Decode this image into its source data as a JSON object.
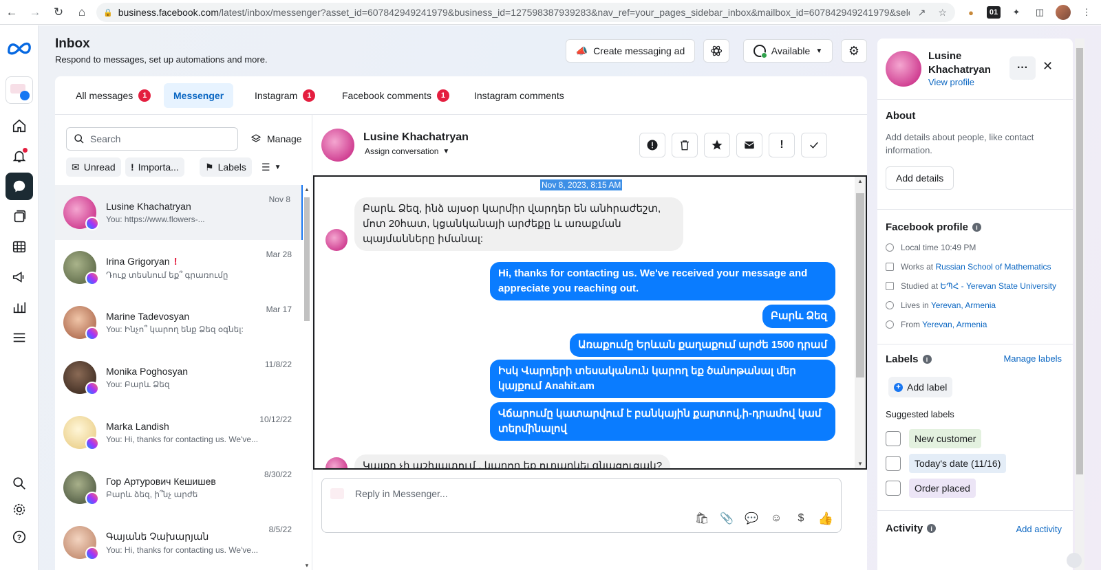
{
  "browser": {
    "url_host": "business.facebook.com",
    "url_path": "/latest/inbox/messenger?asset_id=607842949241979&business_id=127598387939283&nav_ref=your_pages_sidebar_inbox&mailbox_id=607842949241979&selec..."
  },
  "header": {
    "title": "Inbox",
    "subtitle": "Respond to messages, set up automations and more.",
    "create_ad_label": "Create messaging ad",
    "status_label": "Available"
  },
  "tabs": [
    {
      "label": "All messages",
      "badge": "1"
    },
    {
      "label": "Messenger",
      "badge": ""
    },
    {
      "label": "Instagram",
      "badge": "1"
    },
    {
      "label": "Facebook comments",
      "badge": "1"
    },
    {
      "label": "Instagram comments",
      "badge": ""
    }
  ],
  "list": {
    "search_placeholder": "Search",
    "manage_label": "Manage",
    "filters": {
      "unread": "Unread",
      "important": "Importa...",
      "labels": "Labels"
    },
    "conversations": [
      {
        "name": "Lusine Khachatryan",
        "preview": "You: https://www.flowers-...",
        "date": "Nov 8"
      },
      {
        "name": "Irina Grigoryan",
        "preview": "Դուք տեսնում եք՞ գրառումը",
        "date": "Mar 28"
      },
      {
        "name": "Marine Tadevosyan",
        "preview": "You: Ինչո՞ կարող ենք Ձեզ օգնել:",
        "date": "Mar 17"
      },
      {
        "name": "Monika Poghosyan",
        "preview": "You: Բարև Ձեզ",
        "date": "11/8/22"
      },
      {
        "name": "Marka Landish",
        "preview": "You: Hi, thanks for contacting us. We've...",
        "date": "10/12/22"
      },
      {
        "name": "Гор Артурович Кешишев",
        "preview": "Բարև ձեզ, ի՞նչ արժե",
        "date": "8/30/22"
      },
      {
        "name": "Գայանե Չախարյան",
        "preview": "You: Hi, thanks for contacting us. We've...",
        "date": "8/5/22"
      }
    ]
  },
  "chat": {
    "name": "Lusine Khachatryan",
    "assign_label": "Assign conversation",
    "date_stamp": "Nov 8, 2023, 8:15 AM",
    "messages": {
      "in1": "Բարև Ձեզ, ինձ  այսօր կարմիր վարդեր են անհրաժեշտ, մոտ 20հատ, կցանկանայի արժեքը և առաքման պայմանները իմանալ:",
      "out1": "Hi, thanks for contacting us. We've received your message and appreciate you reaching out.",
      "out2": "Բարև Ձեզ",
      "out3": "Առաքումը Երևան քաղաքում արժե 1500 դրամ",
      "out4": "Իսկ Վարդերի տեսականուն կարող եք ծանոթանալ մեր կայքում Anahit.am",
      "out5": "Վճարումը կատարվում է բանկային քարտով,ի-դրամով կամ տերմինալով",
      "in2": "Կայքը չի աշխատում , կարող եք ուղարկել գնացուցակ?"
    },
    "reply_placeholder": "Reply in Messenger..."
  },
  "details": {
    "name": "Lusine Khachatryan",
    "view_profile": "View profile",
    "about_title": "About",
    "about_text": "Add details about people, like contact information.",
    "add_details": "Add details",
    "fb_profile_title": "Facebook profile",
    "local_time": "Local time 10:49 PM",
    "works_prefix": "Works at ",
    "works_at": "Russian School of Mathematics",
    "studied_prefix": "Studied at ",
    "studied_at": "ԵՊՀ - Yerevan State University",
    "lives_prefix": "Lives in ",
    "lives_in": "Yerevan, Armenia",
    "from_prefix": "From ",
    "from": "Yerevan, Armenia",
    "labels_title": "Labels",
    "manage_labels": "Manage labels",
    "add_label": "Add label",
    "suggested_title": "Suggested labels",
    "suggested": [
      {
        "label": "New customer",
        "color": "#e3f1df"
      },
      {
        "label": "Today's date (11/16)",
        "color": "#e4edf7"
      },
      {
        "label": "Order placed",
        "color": "#ece5f6"
      }
    ],
    "activity_title": "Activity",
    "add_activity": "Add activity"
  },
  "colors": {
    "accent": "#1877f2",
    "bubble_out": "#0a7cff",
    "badge_red": "#e41e3f"
  }
}
